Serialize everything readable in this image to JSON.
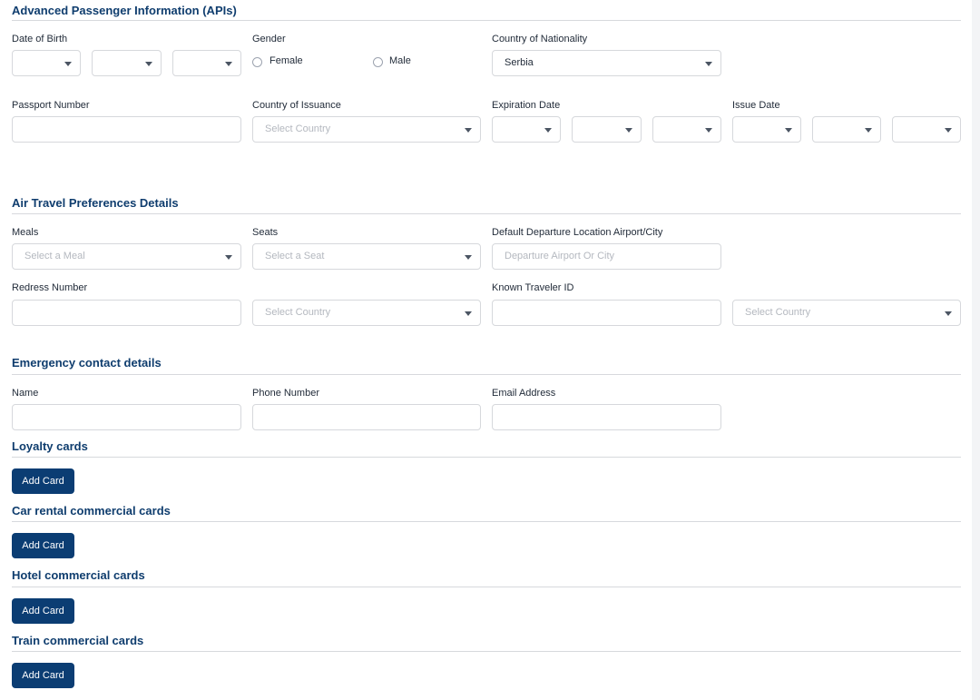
{
  "apis": {
    "title": "Advanced Passenger Information (APIs)",
    "dob_label": "Date of Birth",
    "gender_label": "Gender",
    "female_label": "Female",
    "male_label": "Male",
    "nationality_label": "Country of Nationality",
    "nationality_value": "Serbia",
    "passport_label": "Passport Number",
    "issuance_label": "Country of Issuance",
    "issuance_placeholder": "Select Country",
    "expiration_label": "Expiration Date",
    "issue_label": "Issue Date"
  },
  "air": {
    "title": "Air Travel Preferences Details",
    "meals_label": "Meals",
    "meals_placeholder": "Select a Meal",
    "seats_label": "Seats",
    "seats_placeholder": "Select a Seat",
    "departure_label": "Default Departure Location Airport/City",
    "departure_placeholder": "Departure Airport Or City",
    "redress_label": "Redress Number",
    "redress_country_placeholder": "Select Country",
    "ktid_label": "Known Traveler ID",
    "ktid_country_placeholder": "Select Country"
  },
  "emergency": {
    "title": "Emergency contact details",
    "name_label": "Name",
    "phone_label": "Phone Number",
    "email_label": "Email Address"
  },
  "cards": {
    "loyalty_title": "Loyalty cards",
    "car_title": "Car rental commercial cards",
    "hotel_title": "Hotel commercial cards",
    "train_title": "Train commercial cards",
    "add_label": "Add Card"
  }
}
